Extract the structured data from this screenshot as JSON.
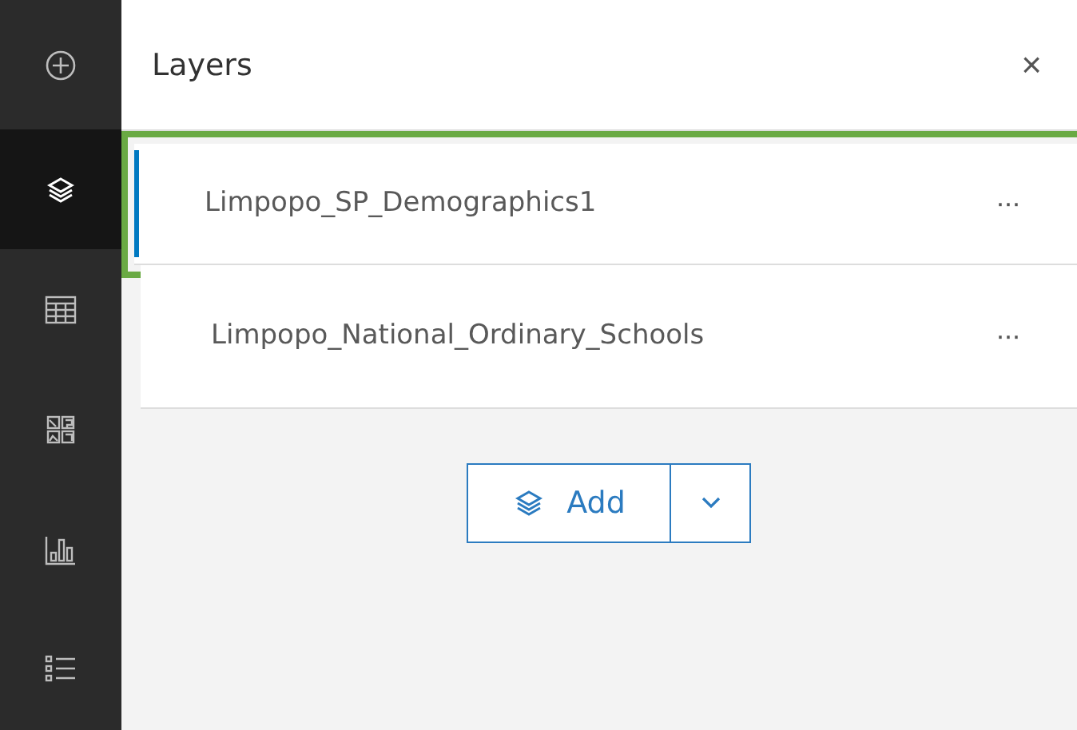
{
  "sidebar": {
    "items": [
      {
        "kind": "add",
        "selected": false
      },
      {
        "kind": "layers",
        "selected": true
      },
      {
        "kind": "table",
        "selected": false
      },
      {
        "kind": "grid",
        "selected": false
      },
      {
        "kind": "chart",
        "selected": false
      },
      {
        "kind": "list",
        "selected": false
      }
    ]
  },
  "panel": {
    "title": "Layers",
    "close": "×"
  },
  "layers": [
    {
      "name": "Limpopo_SP_Demographics1",
      "selected": true,
      "highlighted": true,
      "menu": "···"
    },
    {
      "name": "Limpopo_National_Ordinary_Schools",
      "selected": false,
      "highlighted": false,
      "menu": "···"
    }
  ],
  "add_button": {
    "label": "Add"
  }
}
